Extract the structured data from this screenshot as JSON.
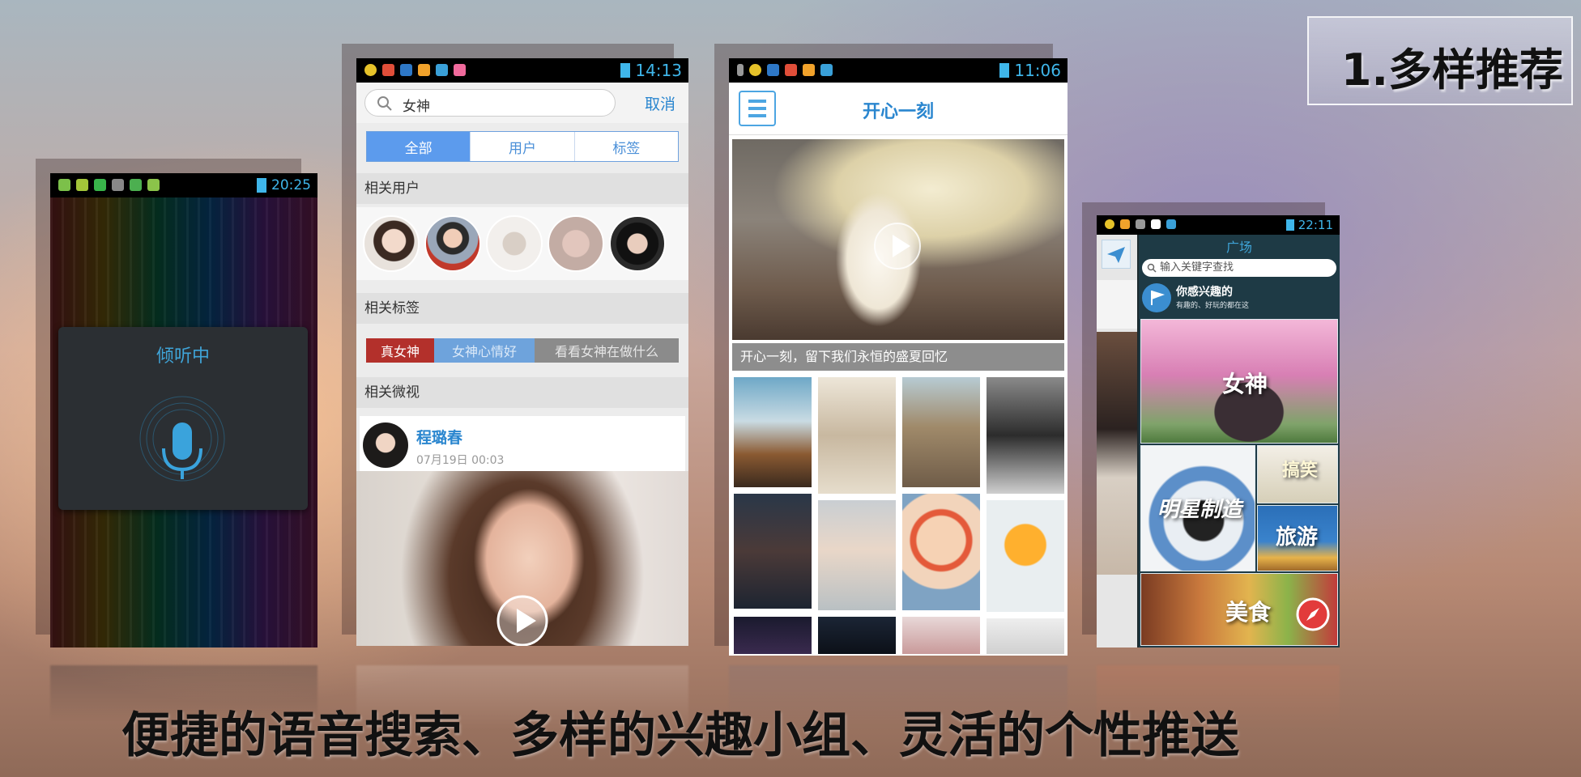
{
  "slide": {
    "title": "1.多样推荐",
    "caption": "便捷的语音搜索、多样的兴趣小组、灵活的个性推送"
  },
  "phone_voice": {
    "time": "20:25",
    "listening_label": "倾听中",
    "icon": "microphone-icon"
  },
  "phone_search": {
    "time": "14:13",
    "query": "女神",
    "cancel_label": "取消",
    "tabs": [
      {
        "label": "全部",
        "active": true
      },
      {
        "label": "用户",
        "active": false
      },
      {
        "label": "标签",
        "active": false
      }
    ],
    "section_users": "相关用户",
    "section_tags": "相关标签",
    "tags": [
      "真女神",
      "女神心情好",
      "看看女神在做什么"
    ],
    "section_micro_video": "相关微视",
    "post": {
      "author": "程璐春",
      "datetime": "07月19日 00:03"
    }
  },
  "phone_gallery": {
    "time": "11:06",
    "title": "开心一刻",
    "caption": "开心一刻，留下我们永恒的盛夏回忆"
  },
  "phone_plaza": {
    "time": "22:11",
    "title": "广场",
    "search_placeholder": "输入关键字查找",
    "interest_title": "你感兴趣的",
    "interest_subtitle": "有趣的、好玩的都在这",
    "tiles": [
      "女神",
      "明星制造",
      "搞笑",
      "旅游",
      "美食"
    ]
  }
}
